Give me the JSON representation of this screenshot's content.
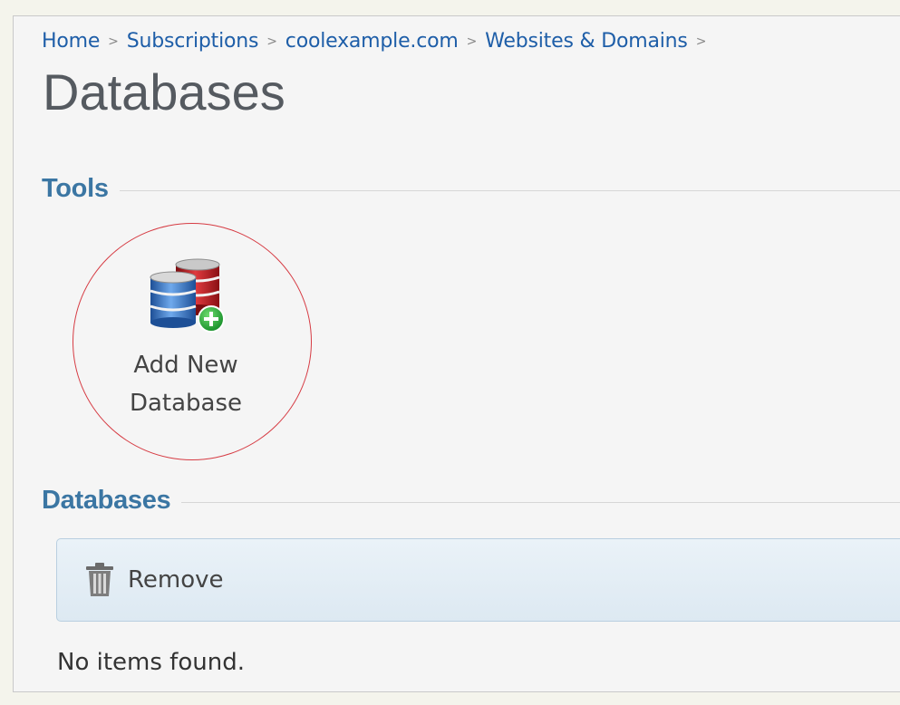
{
  "breadcrumb": {
    "items": [
      "Home",
      "Subscriptions",
      "coolexample.com",
      "Websites & Domains"
    ],
    "separator": ">"
  },
  "page": {
    "title": "Databases"
  },
  "tools": {
    "section_label": "Tools",
    "items": [
      {
        "label_line1": "Add New",
        "label_line2": "Database",
        "icon": "add-database-icon"
      }
    ]
  },
  "databases": {
    "section_label": "Databases",
    "toolbar": {
      "remove_label": "Remove",
      "remove_icon": "trash-icon"
    },
    "empty_message": "No items found."
  },
  "colors": {
    "link": "#1e5ea8",
    "section_heading": "#3b76a3",
    "highlight_circle": "#d63b43",
    "toolbar_bg": "#dde9f2"
  }
}
